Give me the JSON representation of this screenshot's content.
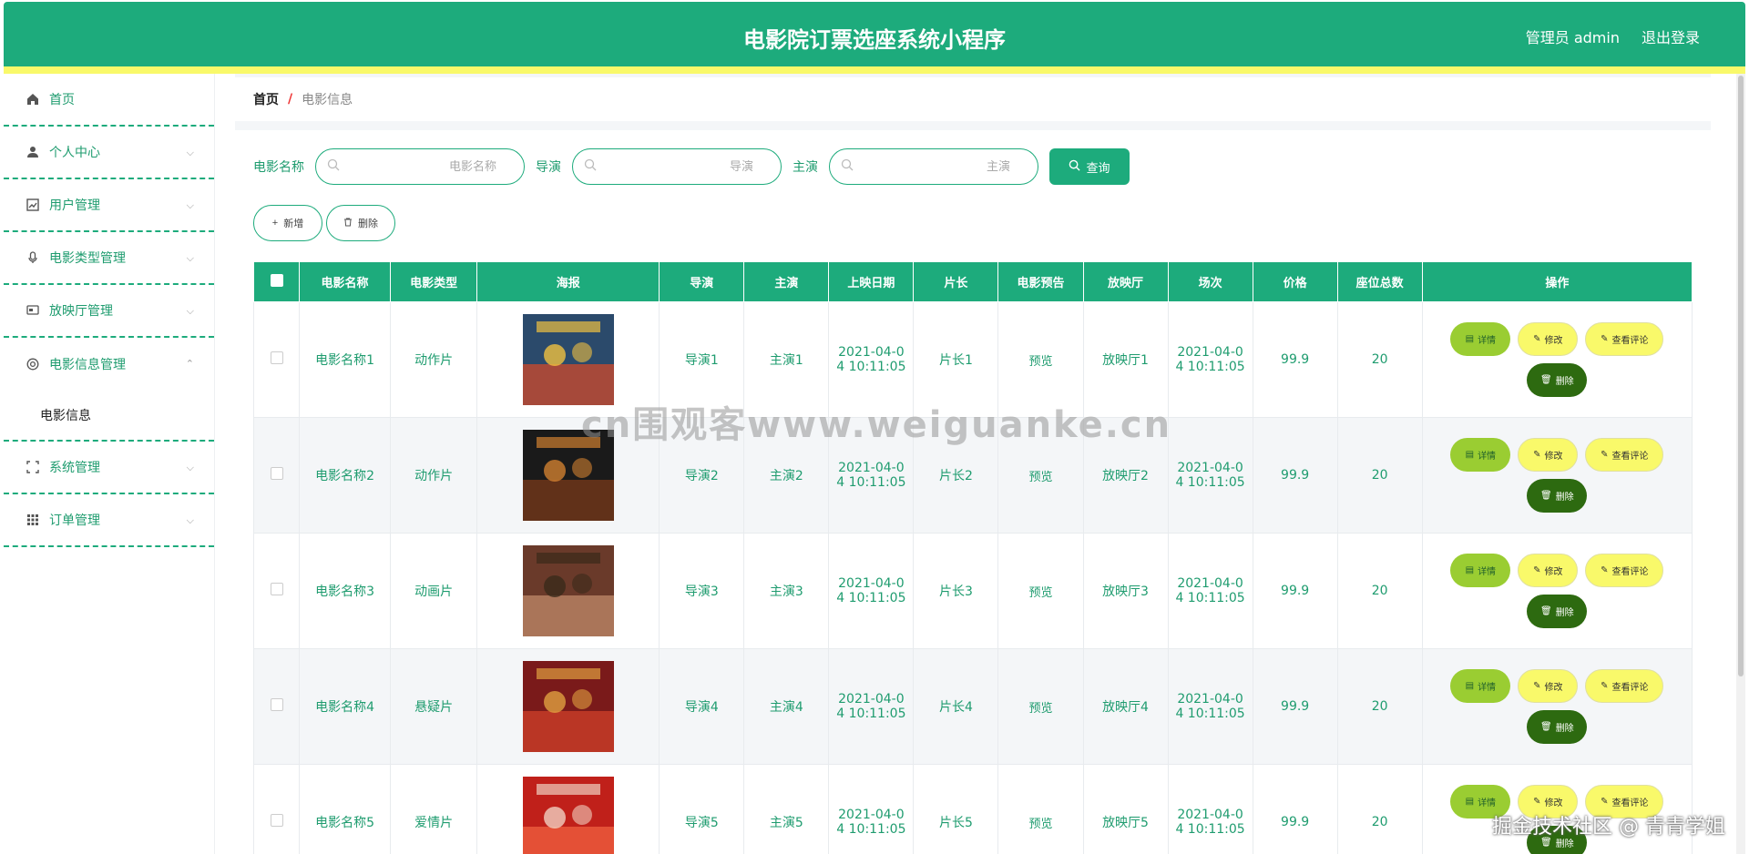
{
  "header": {
    "title": "电影院订票选座系统小程序",
    "user": "管理员 admin",
    "logout": "退出登录"
  },
  "sidebar": {
    "items": [
      {
        "label": "首页",
        "icon": "home-icon",
        "has_arrow": false
      },
      {
        "label": "个人中心",
        "icon": "user-icon",
        "has_arrow": true
      },
      {
        "label": "用户管理",
        "icon": "chart-icon",
        "has_arrow": true
      },
      {
        "label": "电影类型管理",
        "icon": "mic-icon",
        "has_arrow": true
      },
      {
        "label": "放映厅管理",
        "icon": "screen-icon",
        "has_arrow": true
      },
      {
        "label": "电影信息管理",
        "icon": "film-icon",
        "has_arrow": true,
        "expanded": true,
        "sub": [
          "电影信息"
        ]
      },
      {
        "label": "系统管理",
        "icon": "frame-icon",
        "has_arrow": true
      },
      {
        "label": "订单管理",
        "icon": "grid-icon",
        "has_arrow": true
      }
    ]
  },
  "breadcrumb": {
    "home": "首页",
    "sep": "/",
    "current": "电影信息"
  },
  "search": {
    "name_label": "电影名称",
    "name_placeholder": "电影名称",
    "director_label": "导演",
    "director_placeholder": "导演",
    "actor_label": "主演",
    "actor_placeholder": "主演",
    "query_label": "查询"
  },
  "actions": {
    "add_label": "新增",
    "delete_label": "删除"
  },
  "table": {
    "columns": [
      "电影名称",
      "电影类型",
      "海报",
      "导演",
      "主演",
      "上映日期",
      "片长",
      "电影预告",
      "放映厅",
      "场次",
      "价格",
      "座位总数",
      "操作"
    ],
    "rows": [
      {
        "name": "电影名称1",
        "type": "动作片",
        "director": "导演1",
        "actor": "主演1",
        "date_l1": "2021-04-0",
        "date_l2": "4 10:11:05",
        "length": "片长1",
        "preview": "预览",
        "hall": "放映厅1",
        "session_l1": "2021-04-0",
        "session_l2": "4 10:11:05",
        "price": "99.9",
        "seats": "20"
      },
      {
        "name": "电影名称2",
        "type": "动作片",
        "director": "导演2",
        "actor": "主演2",
        "date_l1": "2021-04-0",
        "date_l2": "4 10:11:05",
        "length": "片长2",
        "preview": "预览",
        "hall": "放映厅2",
        "session_l1": "2021-04-0",
        "session_l2": "4 10:11:05",
        "price": "99.9",
        "seats": "20"
      },
      {
        "name": "电影名称3",
        "type": "动画片",
        "director": "导演3",
        "actor": "主演3",
        "date_l1": "2021-04-0",
        "date_l2": "4 10:11:05",
        "length": "片长3",
        "preview": "预览",
        "hall": "放映厅3",
        "session_l1": "2021-04-0",
        "session_l2": "4 10:11:05",
        "price": "99.9",
        "seats": "20"
      },
      {
        "name": "电影名称4",
        "type": "悬疑片",
        "director": "导演4",
        "actor": "主演4",
        "date_l1": "2021-04-0",
        "date_l2": "4 10:11:05",
        "length": "片长4",
        "preview": "预览",
        "hall": "放映厅4",
        "session_l1": "2021-04-0",
        "session_l2": "4 10:11:05",
        "price": "99.9",
        "seats": "20"
      },
      {
        "name": "电影名称5",
        "type": "爱情片",
        "director": "导演5",
        "actor": "主演5",
        "date_l1": "2021-04-0",
        "date_l2": "4 10:11:05",
        "length": "片长5",
        "preview": "预览",
        "hall": "放映厅5",
        "session_l1": "2021-04-0",
        "session_l2": "4 10:11:05",
        "price": "99.9",
        "seats": "20"
      }
    ],
    "ops": {
      "detail": "详情",
      "edit": "修改",
      "review": "查看评论",
      "delete": "删除"
    }
  },
  "watermark": "cn围观客www.weiguanke.cn",
  "corner_watermark": "掘金技术社区 @ 青青学姐",
  "colors": {
    "primary": "#1dab7c",
    "accent_yellow": "#f9f96a",
    "detail_green": "#9acd32",
    "delete_dark": "#2d6a10"
  }
}
